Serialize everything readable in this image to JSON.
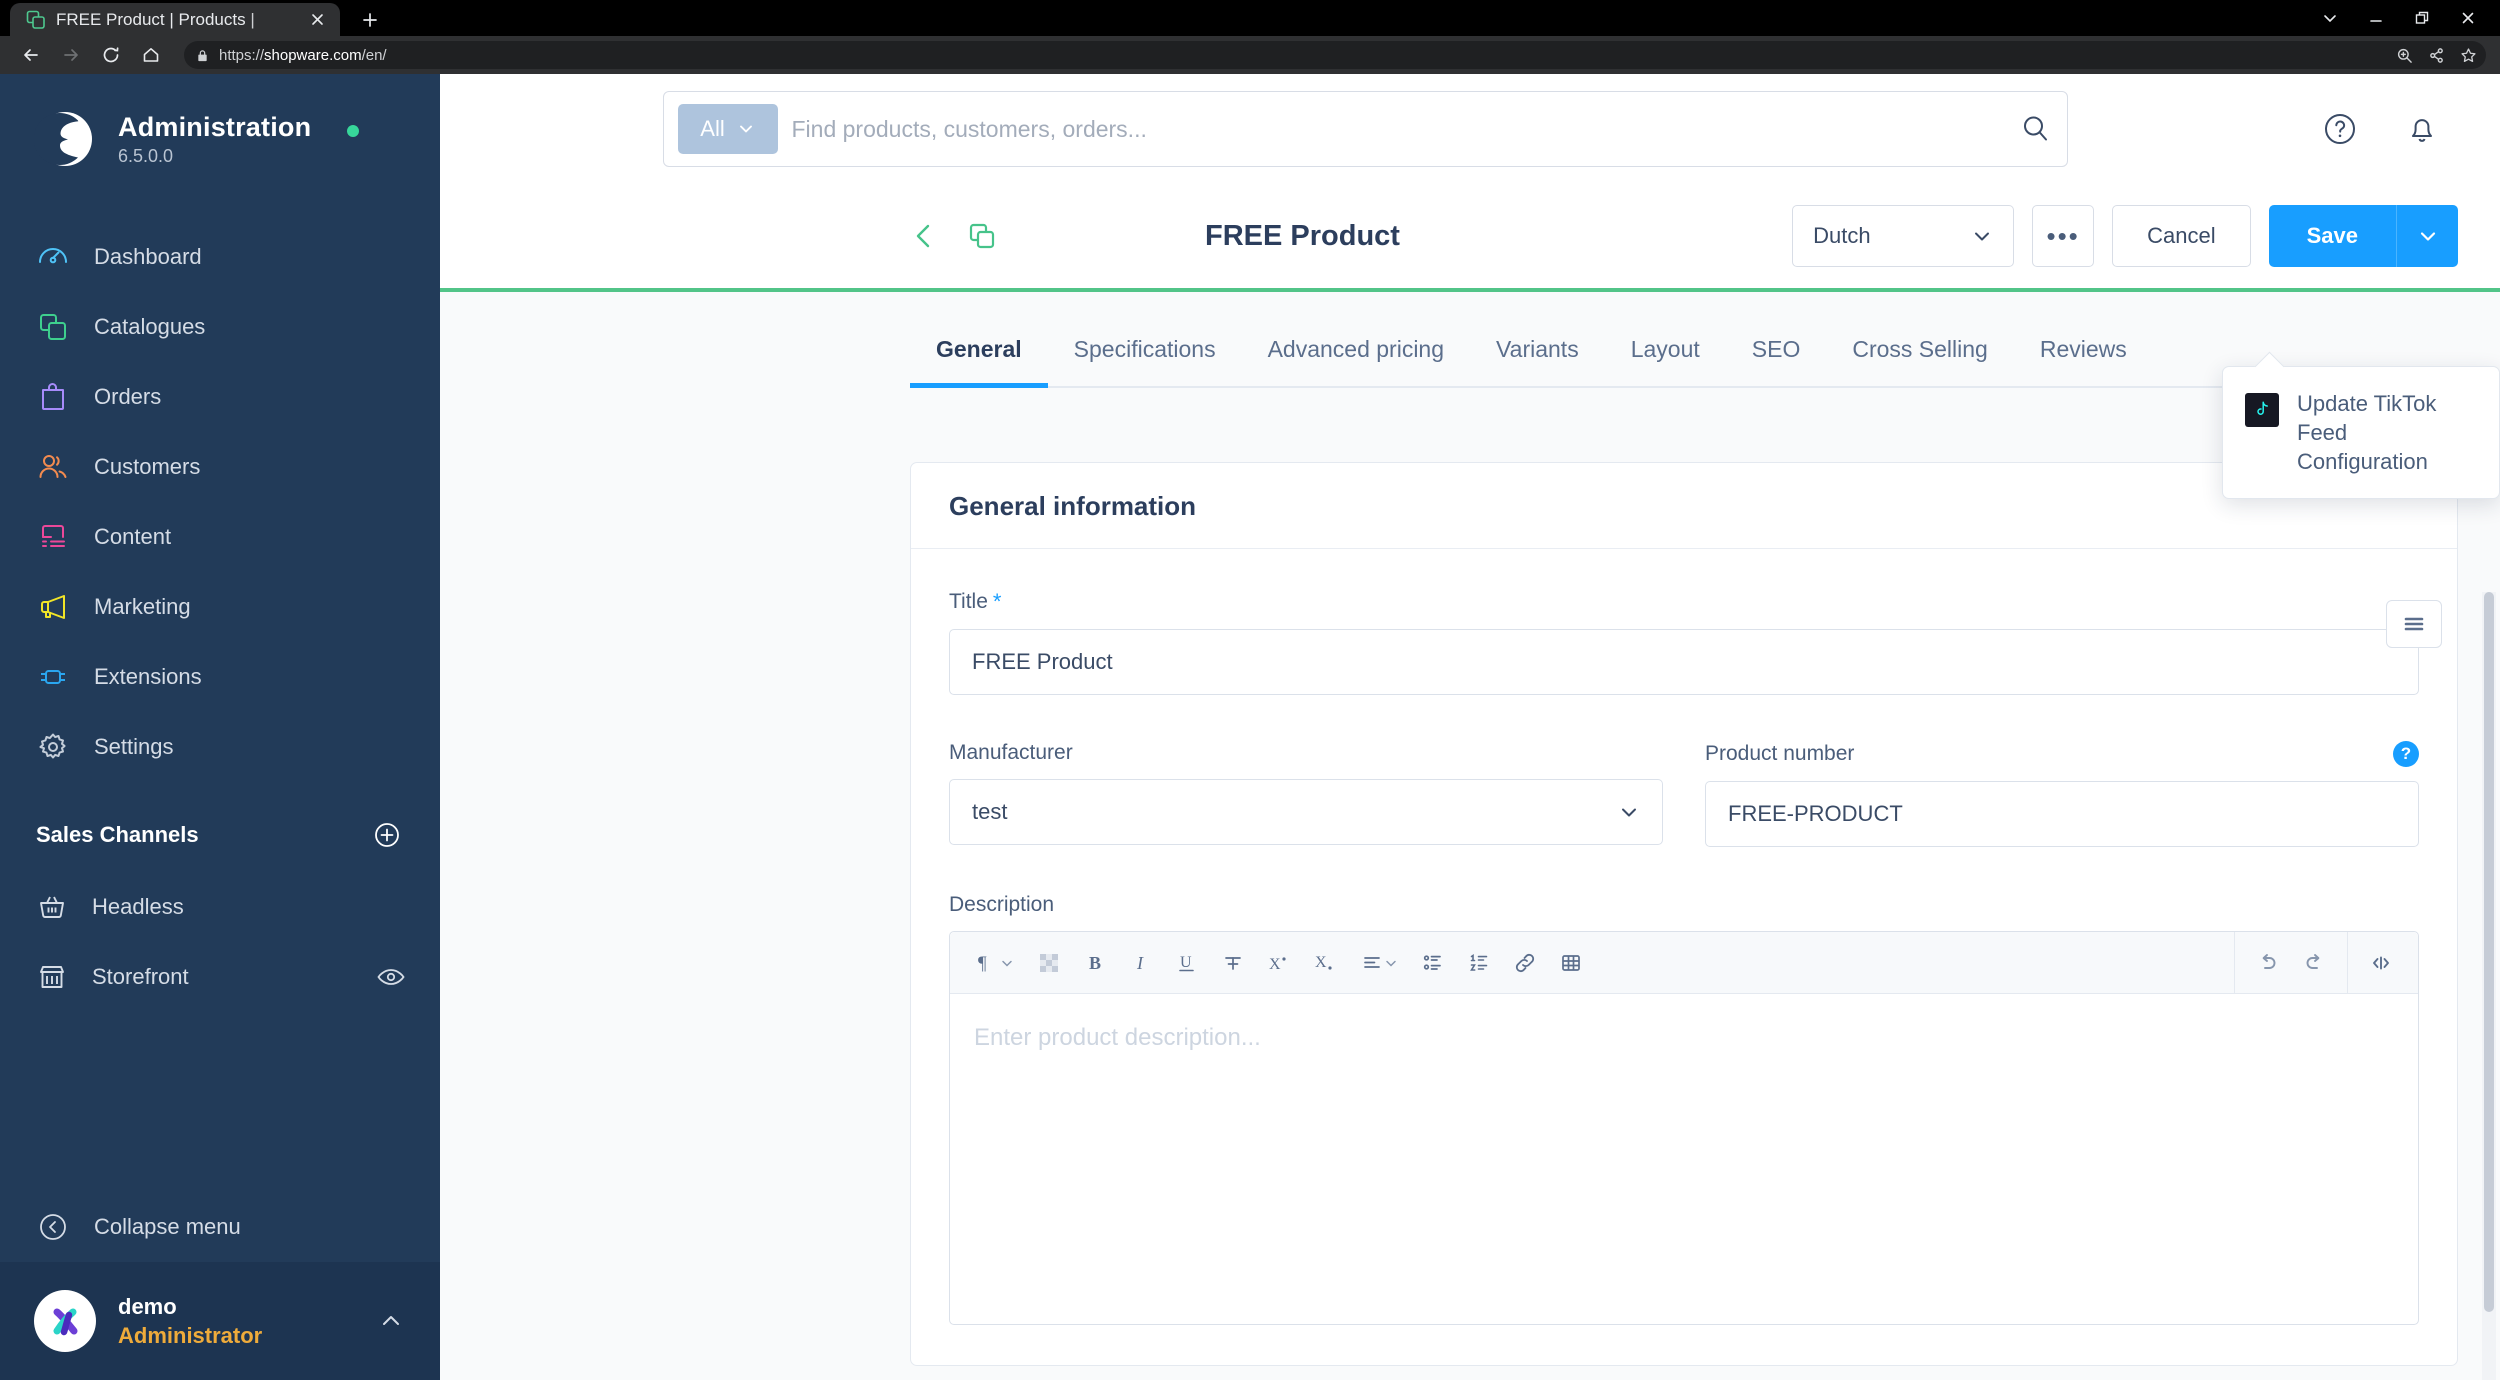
{
  "browser": {
    "tab_title": "FREE Product | Products |",
    "url_prefix": "https://",
    "url_bold": "shopware.com",
    "url_suffix": "/en/",
    "new_tab_label": "+",
    "icons": {
      "favicon": "shopware-tab-favicon",
      "close": "close-icon",
      "back": "back-icon",
      "forward": "forward-icon",
      "reload": "reload-icon",
      "home": "home-icon",
      "lock": "lock-icon",
      "zoom": "zoom-icon",
      "share": "share-icon",
      "bookmark": "star-icon",
      "minimize": "minimize-icon",
      "maximize": "restore-icon",
      "window_close": "close-icon",
      "tab_search": "chevron-down-icon"
    }
  },
  "sidebar": {
    "app_name": "Administration",
    "version": "6.5.0.0",
    "status": "online",
    "items": [
      {
        "label": "Dashboard",
        "icon": "dashboard-icon",
        "color": "#4fc3f7"
      },
      {
        "label": "Catalogues",
        "icon": "catalogues-icon",
        "color": "#3ecf8e"
      },
      {
        "label": "Orders",
        "icon": "orders-icon",
        "color": "#a78bfa"
      },
      {
        "label": "Customers",
        "icon": "customers-icon",
        "color": "#f38b4f"
      },
      {
        "label": "Content",
        "icon": "content-icon",
        "color": "#ec4899"
      },
      {
        "label": "Marketing",
        "icon": "marketing-icon",
        "color": "#f2e527"
      },
      {
        "label": "Extensions",
        "icon": "extensions-icon",
        "color": "#2aa6f0"
      },
      {
        "label": "Settings",
        "icon": "settings-icon",
        "color": "#c4cdd9"
      }
    ],
    "sales_channels_title": "Sales Channels",
    "add_channel_icon": "plus-circle-icon",
    "channels": [
      {
        "label": "Headless",
        "icon": "basket-icon",
        "trailing": ""
      },
      {
        "label": "Storefront",
        "icon": "store-icon",
        "trailing": "eye-icon"
      }
    ],
    "collapse_label": "Collapse menu",
    "collapse_icon": "chevron-left-circle-icon",
    "user": {
      "name": "demo",
      "role": "Administrator",
      "chevron": "chevron-up-icon",
      "avatar": "user-avatar"
    }
  },
  "topbar": {
    "search_scope": "All",
    "search_placeholder": "Find products, customers, orders...",
    "search_icon": "search-icon",
    "scope_caret": "chevron-down-icon",
    "help_icon": "help-circle-icon",
    "notification_icon": "bell-icon"
  },
  "header": {
    "back_icon": "chevron-left-icon",
    "duplicate_icon": "duplicate-icon",
    "title": "FREE Product",
    "language": "Dutch",
    "language_caret": "chevron-down-icon",
    "context_button": "•••",
    "cancel_label": "Cancel",
    "save_label": "Save",
    "save_caret": "chevron-down-icon",
    "accent_color": "#189eff",
    "rule_color": "#52c488"
  },
  "context_menu": {
    "items": [
      {
        "label": "Update TikTok Feed Configuration",
        "icon": "tiktok-icon"
      }
    ]
  },
  "tabs": [
    {
      "label": "General",
      "active": true
    },
    {
      "label": "Specifications",
      "active": false
    },
    {
      "label": "Advanced pricing",
      "active": false
    },
    {
      "label": "Variants",
      "active": false
    },
    {
      "label": "Layout",
      "active": false
    },
    {
      "label": "SEO",
      "active": false
    },
    {
      "label": "Cross Selling",
      "active": false
    },
    {
      "label": "Reviews",
      "active": false
    }
  ],
  "list_toggle_icon": "list-view-icon",
  "card": {
    "title": "General information",
    "title_label": "Title",
    "title_required": "*",
    "title_value": "FREE Product",
    "manufacturer_label": "Manufacturer",
    "manufacturer_value": "test",
    "manufacturer_caret": "chevron-down-icon",
    "product_number_label": "Product number",
    "product_number_value": "FREE-PRODUCT",
    "product_number_help": "?",
    "description_label": "Description",
    "description_placeholder": "Enter product description..."
  },
  "editor_toolbar": {
    "buttons": [
      {
        "name": "paragraph-format-icon",
        "glyph": "¶",
        "caret": true
      },
      {
        "name": "text-color-icon",
        "glyph": "",
        "caret": false
      },
      {
        "name": "bold-icon",
        "glyph": "B",
        "caret": false
      },
      {
        "name": "italic-icon",
        "glyph": "I",
        "caret": false
      },
      {
        "name": "underline-icon",
        "glyph": "U",
        "caret": false
      },
      {
        "name": "strikethrough-icon",
        "glyph": "S",
        "caret": false
      },
      {
        "name": "superscript-icon",
        "glyph": "X",
        "caret": false
      },
      {
        "name": "subscript-icon",
        "glyph": "X",
        "caret": false
      },
      {
        "name": "align-icon",
        "glyph": "",
        "caret": true
      },
      {
        "name": "bulleted-list-icon",
        "glyph": "",
        "caret": false
      },
      {
        "name": "numbered-list-icon",
        "glyph": "",
        "caret": false
      },
      {
        "name": "link-icon",
        "glyph": "",
        "caret": false
      },
      {
        "name": "table-icon",
        "glyph": "",
        "caret": false
      }
    ],
    "right_buttons": [
      {
        "name": "undo-icon"
      },
      {
        "name": "redo-icon"
      },
      {
        "name": "code-view-icon"
      }
    ]
  }
}
